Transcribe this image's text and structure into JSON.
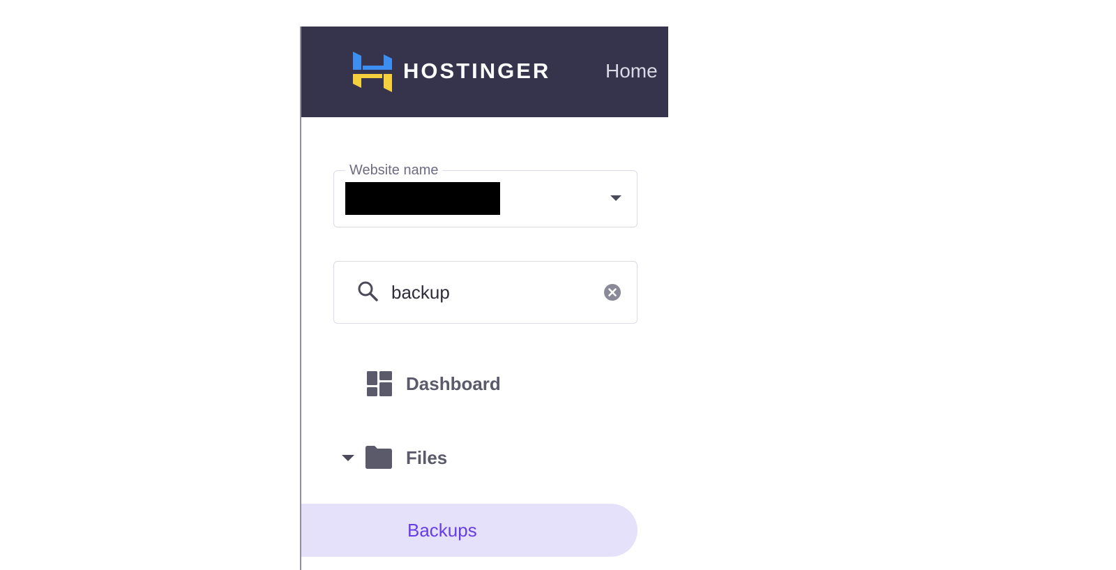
{
  "header": {
    "brand": "HOSTINGER",
    "nav_home": "Home",
    "logo_icon": "hostinger-logo",
    "background": "#36344d"
  },
  "website_select": {
    "label": "Website name",
    "value_redacted": true,
    "dropdown_icon": "caret-down-icon"
  },
  "search": {
    "value": "backup",
    "icon": "search-icon",
    "clear_icon": "clear-circle-icon"
  },
  "sidebar": {
    "items": [
      {
        "label": "Dashboard",
        "icon": "dashboard-icon"
      },
      {
        "label": "Files",
        "icon": "folder-icon",
        "expanded": true
      },
      {
        "label": "Backups",
        "active": true
      }
    ],
    "active_color": "#673de6",
    "active_background": "#e5e1fb"
  }
}
